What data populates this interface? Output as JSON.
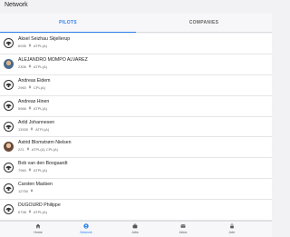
{
  "header": {
    "title": "Network"
  },
  "tabs": [
    {
      "label": "PILOTS",
      "active": true
    },
    {
      "label": "COMPANIES",
      "active": false
    }
  ],
  "pilots": [
    {
      "name": "Aksel Seizhau Skjellerup",
      "id": "6935",
      "ratings": "ATPL(A)",
      "avatar": "generic"
    },
    {
      "name": "ALEJANDRO MOMPO ALVAREZ",
      "id": "2306",
      "ratings": "ATPL(A)",
      "avatar": "photo1"
    },
    {
      "name": "Andreas Eidem",
      "id": "2960",
      "ratings": "CPL(A)",
      "avatar": "generic"
    },
    {
      "name": "Andreas Hinen",
      "id": "5966",
      "ratings": "ATPL(A)",
      "avatar": "generic"
    },
    {
      "name": "Arild Johannesen",
      "id": "13930",
      "ratings": "ATPL(A)",
      "avatar": "generic"
    },
    {
      "name": "Astrid Blomstrøm Nielsen",
      "id": "221",
      "ratings": "ATPL(A)  CPL(A)",
      "avatar": "photo2"
    },
    {
      "name": "Bob van den Boogaardt",
      "id": "7960",
      "ratings": "ATPL(A)",
      "avatar": "generic"
    },
    {
      "name": "Carsten Madsen",
      "id": "12750",
      "ratings": "",
      "avatar": "generic"
    },
    {
      "name": "DUGOURD Philippe",
      "id": "6798",
      "ratings": "ATPL(A)",
      "avatar": "generic"
    },
    {
      "name": "Elisa Vouliganis",
      "id": "2206",
      "ratings": "ATPL(A)",
      "avatar": "generic"
    }
  ],
  "bottom_nav": [
    {
      "label": "Home",
      "icon": "home-icon",
      "active": false
    },
    {
      "label": "Network",
      "icon": "network-icon",
      "active": true
    },
    {
      "label": "Jobs",
      "icon": "briefcase-icon",
      "active": false
    },
    {
      "label": "Inbox",
      "icon": "inbox-icon",
      "active": false
    },
    {
      "label": "Jobr",
      "icon": "lock-icon",
      "active": false
    }
  ],
  "colors": {
    "accent": "#2f80ed",
    "background": "#f2f2f4"
  }
}
